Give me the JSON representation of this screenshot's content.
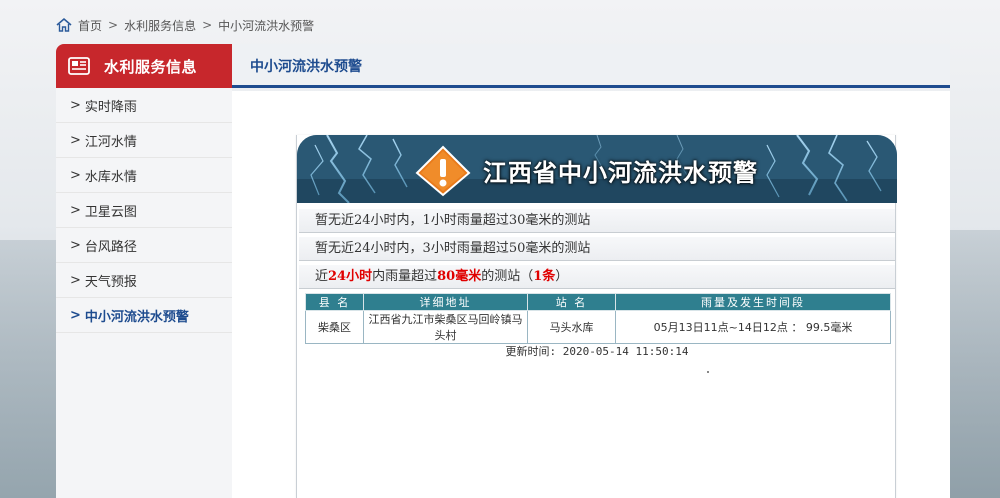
{
  "breadcrumb": {
    "home": "首页",
    "sep": ">",
    "level1": "水利服务信息",
    "level2": "中小河流洪水预警"
  },
  "sidebar": {
    "header": "水利服务信息",
    "items": [
      {
        "label": "实时降雨",
        "active": false
      },
      {
        "label": "江河水情",
        "active": false
      },
      {
        "label": "水库水情",
        "active": false
      },
      {
        "label": "卫星云图",
        "active": false
      },
      {
        "label": "台风路径",
        "active": false
      },
      {
        "label": "天气预报",
        "active": false
      },
      {
        "label": "中小河流洪水预警",
        "active": true
      }
    ],
    "chevron": ">"
  },
  "main": {
    "section_title": "中小河流洪水预警",
    "banner_title": "江西省中小河流洪水预警",
    "notice1": "暂无近24小时内，1小时雨量超过30毫米的测站",
    "notice2": "暂无近24小时内，3小时雨量超过50毫米的测站",
    "notice3": {
      "pre": "近",
      "hours": "24小时",
      "mid": "内雨量超过",
      "mm": "80毫米",
      "post": "的测站（",
      "count": "1条",
      "end": "）"
    },
    "table": {
      "headers": [
        "县 名",
        "详细地址",
        "站 名",
        "雨量及发生时间段"
      ],
      "rows": [
        [
          "柴桑区",
          "江西省九江市柴桑区马回岭镇马头村",
          "马头水库",
          "05月13日11点~14日12点 ： 99.5毫米"
        ]
      ]
    },
    "update_time": "更新时间: 2020-05-14 11:50:14"
  },
  "colors": {
    "brand_red": "#c7272c",
    "nav_blue": "#1e4c8f",
    "table_header": "#2f7f8f",
    "alert_red": "#e00000"
  }
}
